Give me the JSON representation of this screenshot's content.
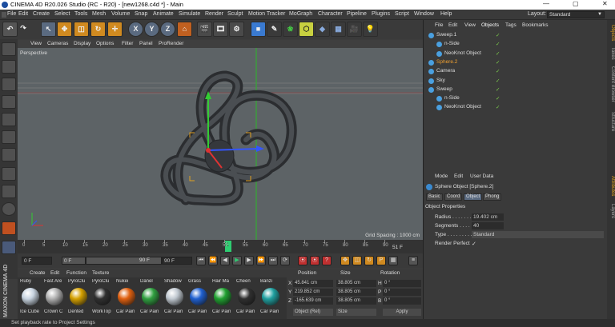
{
  "window": {
    "title": "CINEMA 4D R20.026 Studio (RC - R20) - [new1268.c4d *] - Main",
    "controls": [
      "—",
      "▢",
      "✕"
    ]
  },
  "menu": [
    "File",
    "Edit",
    "Create",
    "Select",
    "Tools",
    "Mesh",
    "Volume",
    "Snap",
    "Animate",
    "Simulate",
    "Render",
    "Sculpt",
    "Motion Tracker",
    "MoGraph",
    "Character",
    "Pipeline",
    "Plugins",
    "Script",
    "Window",
    "Help"
  ],
  "layout": {
    "label": "Layout:",
    "value": "Standard"
  },
  "toolbar": {
    "x": "X",
    "y": "Y",
    "z": "Z"
  },
  "viewport": {
    "menu": [
      "View",
      "Cameras",
      "Display",
      "Options",
      "Filter",
      "Panel",
      "ProRender"
    ],
    "label": "Perspective",
    "grid_spacing": "Grid Spacing : 1000 cm"
  },
  "timeline": {
    "ticks": [
      "0",
      "5",
      "10",
      "15",
      "20",
      "25",
      "30",
      "35",
      "40",
      "45",
      "50",
      "55",
      "60",
      "65",
      "70",
      "75",
      "80",
      "85",
      "90"
    ],
    "current_marker": "51",
    "current_frame": "51 F",
    "start": "0 F",
    "start2": "0 F",
    "end1": "90 F",
    "end2": "90 F"
  },
  "materials": {
    "menu": [
      "Create",
      "Edit",
      "Function",
      "Texture"
    ],
    "items": [
      {
        "top": "Ruby",
        "bottom": "Ice Cube",
        "color": "#c8d4e0"
      },
      {
        "top": "Fast Are",
        "bottom": "Crown C",
        "color": "#b0b0b0"
      },
      {
        "top": "PyroClu",
        "bottom": "Dented",
        "color": "#d4a000"
      },
      {
        "top": "PyroClu",
        "bottom": "WorkTop",
        "color": "#303030"
      },
      {
        "top": "Nukei",
        "bottom": "Car Pain",
        "color": "#e06010"
      },
      {
        "top": "Danel",
        "bottom": "Car Pain",
        "color": "#30a040"
      },
      {
        "top": "Shadow",
        "bottom": "Car Pain",
        "color": "#c0c8d0"
      },
      {
        "top": "Grass",
        "bottom": "Car Pain",
        "color": "#2060d0"
      },
      {
        "top": "Hair Ma",
        "bottom": "Car Pain",
        "color": "#20a030"
      },
      {
        "top": "Cheen",
        "bottom": "Car Pain",
        "color": "#303030"
      },
      {
        "top": "Banzi",
        "bottom": "Car Pain",
        "color": "#20a0a0"
      }
    ]
  },
  "coords": {
    "headers": [
      "Position",
      "Size",
      "Rotation"
    ],
    "rows": [
      {
        "axis": "X",
        "pos": "45.841 cm",
        "size": "38.805 cm",
        "rot_axis": "H",
        "rot": "0 °"
      },
      {
        "axis": "Y",
        "pos": "219.852 cm",
        "size": "38.805 cm",
        "rot_axis": "P",
        "rot": "0 °"
      },
      {
        "axis": "Z",
        "pos": "-165.639 cm",
        "size": "38.805 cm",
        "rot_axis": "B",
        "rot": "0 °"
      }
    ],
    "mode": "Object (Rel)",
    "size_mode": "Size",
    "apply": "Apply"
  },
  "objects": {
    "menu": [
      "File",
      "Edit",
      "View",
      "Objects",
      "Tags",
      "Bookmarks"
    ],
    "rows": [
      {
        "name": "Sweep.1",
        "indent": 1,
        "color": "#ddd"
      },
      {
        "name": "n-Side",
        "indent": 2,
        "color": "#ddd"
      },
      {
        "name": "NeoKnot Object",
        "indent": 2,
        "color": "#ddd"
      },
      {
        "name": "Sphere.2",
        "indent": 1,
        "color": "#f0a030"
      },
      {
        "name": "Camera",
        "indent": 1,
        "color": "#ddd"
      },
      {
        "name": "Sky",
        "indent": 1,
        "color": "#ddd"
      },
      {
        "name": "Sweep",
        "indent": 1,
        "color": "#ddd"
      },
      {
        "name": "n-Side",
        "indent": 2,
        "color": "#ddd"
      },
      {
        "name": "NeoKnot Object",
        "indent": 2,
        "color": "#ddd"
      }
    ]
  },
  "attributes": {
    "menu": [
      "Mode",
      "Edit",
      "User Data"
    ],
    "title": "Sphere Object [Sphere.2]",
    "tabs": [
      "Basic",
      "Coord",
      "Object",
      "Phong"
    ],
    "section": "Object Properties",
    "props": [
      {
        "label": "Radius . . . . . . .",
        "value": "19.402 cm"
      },
      {
        "label": "Segments . . . . .",
        "value": "40"
      },
      {
        "label": "Type . . . . . . . . .",
        "value": "Standard"
      },
      {
        "label": "Render Perfect",
        "value": "✓"
      }
    ]
  },
  "right_tabs": [
    "Objects",
    "Takes",
    "Content Browser",
    "Structure",
    "Attributes",
    "Layers"
  ],
  "status": "Set playback rate to Project Settings"
}
